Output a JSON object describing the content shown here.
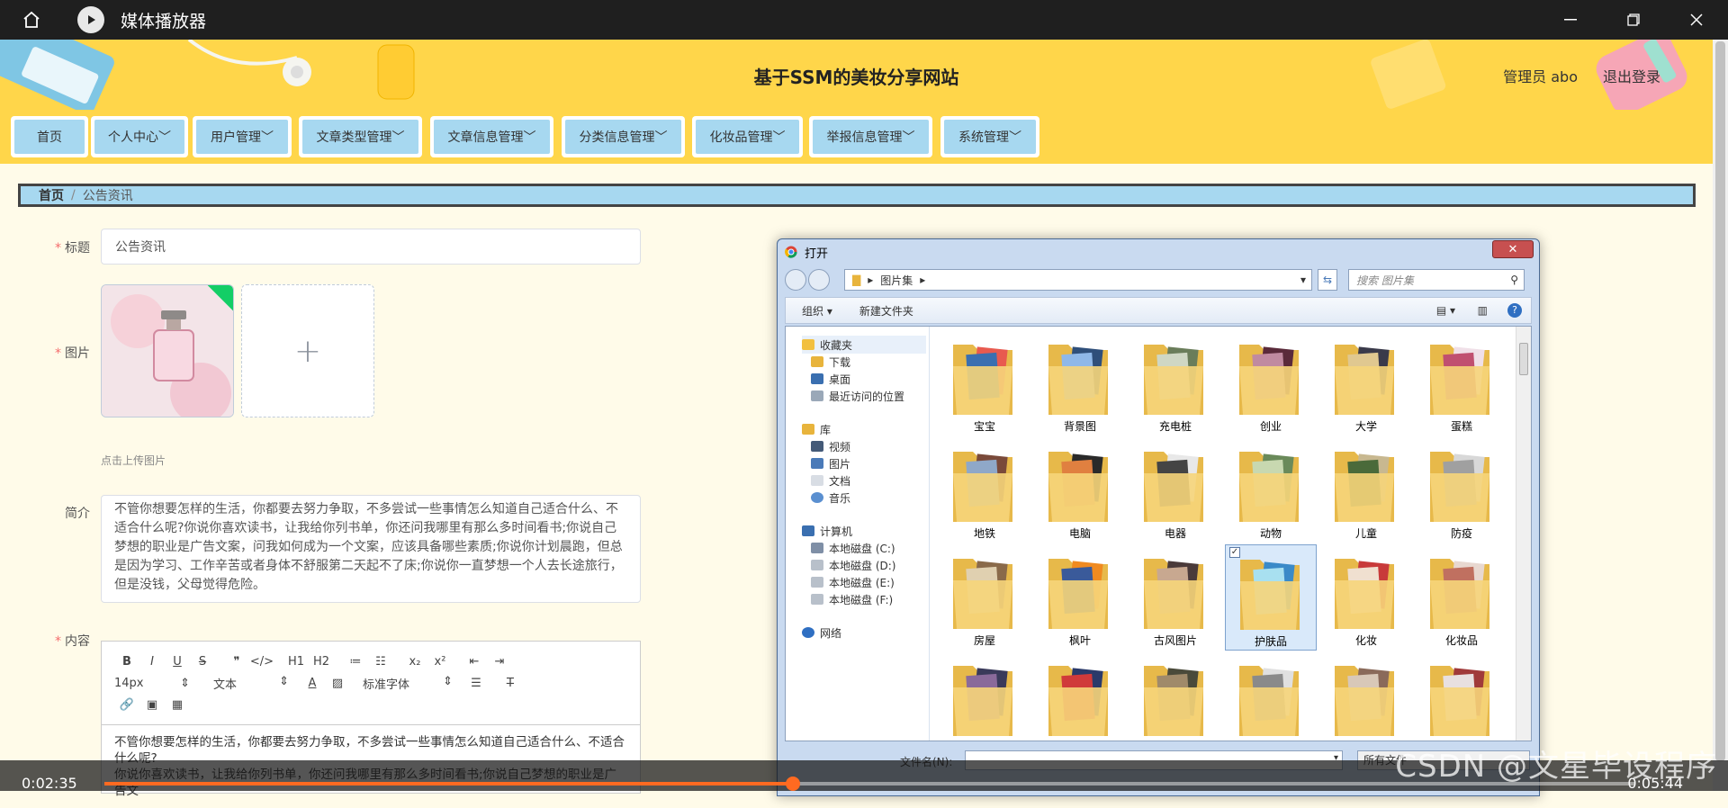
{
  "player": {
    "title": "媒体播放器",
    "current_time": "0:02:35",
    "total_time": "0:05:44",
    "progress": 0.45,
    "watermark": "CSDN @文星毕设程序"
  },
  "site": {
    "title": "基于SSM的美妆分享网站",
    "user_label": "管理员 abo",
    "logout_label": "退出登录"
  },
  "nav": {
    "items": [
      "首页",
      "个人中心",
      "用户管理",
      "文章类型管理",
      "文章信息管理",
      "分类信息管理",
      "化妆品管理",
      "举报信息管理",
      "系统管理"
    ]
  },
  "breadcrumb": {
    "home": "首页",
    "separator": "/",
    "current": "公告资讯"
  },
  "form": {
    "title_label": "标题",
    "title_value": "公告资讯",
    "image_label": "图片",
    "upload_tip": "点击上传图片",
    "summary_label": "简介",
    "summary_value": "不管你想要怎样的生活，你都要去努力争取，不多尝试一些事情怎么知道自己适合什么、不适合什么呢?你说你喜欢读书，让我给你列书单，你还问我哪里有那么多时间看书;你说自己梦想的职业是广告文案，问我如何成为一个文案，应该具备哪些素质;你说你计划晨跑，但总是因为学习、工作辛苦或者身体不舒服第二天起不了床;你说你一直梦想一个人去长途旅行，但是没钱，父母觉得危险。",
    "content_label": "内容",
    "editor": {
      "row1": [
        "B",
        "I",
        "U",
        "S",
        "❞",
        "</>",
        "H1",
        "H2",
        "≔",
        "☷",
        "x₂",
        "x²",
        "⇤",
        "⇥"
      ],
      "font_size": "14px",
      "paragraph": "文本",
      "font_family": "标准字体",
      "row3": [
        "🔗",
        "▣",
        "▦"
      ],
      "body_line1": "不管你想要怎样的生活，你都要去努力争取，不多尝试一些事情怎么知道自己适合什么、不适合什么呢?",
      "body_line2": "你说你喜欢读书，让我给你列书单，你还问我哪里有那么多时间看书;你说自己梦想的职业是广告文"
    }
  },
  "dialog": {
    "title": "打开",
    "path": "图片集",
    "search_placeholder": "搜索 图片集",
    "organize": "组织 ▾",
    "new_folder": "新建文件夹",
    "tree": {
      "favorites": "收藏夹",
      "fav_items": [
        "下载",
        "桌面",
        "最近访问的位置"
      ],
      "library": "库",
      "lib_items": [
        "视频",
        "图片",
        "文档",
        "音乐"
      ],
      "computer": "计算机",
      "drives": [
        "本地磁盘 (C:)",
        "本地磁盘 (D:)",
        "本地磁盘 (E:)",
        "本地磁盘 (F:)"
      ],
      "network": "网络"
    },
    "folders": [
      "宝宝",
      "背景图",
      "充电桩",
      "创业",
      "大学",
      "蛋糕",
      "地铁",
      "电脑",
      "电器",
      "动物",
      "儿童",
      "防疫",
      "房屋",
      "枫叶",
      "古风图片",
      "护肤品",
      "化妆",
      "化妆品",
      "",
      "",
      "",
      "",
      "",
      ""
    ],
    "selected_folder": "护肤品",
    "filename_label": "文件名(N):",
    "filter_label": "所有文件"
  },
  "colors": {
    "header_yellow": "#ffd64a",
    "nav_blue": "#a7d8f0",
    "progress_orange": "#ff6a21"
  }
}
